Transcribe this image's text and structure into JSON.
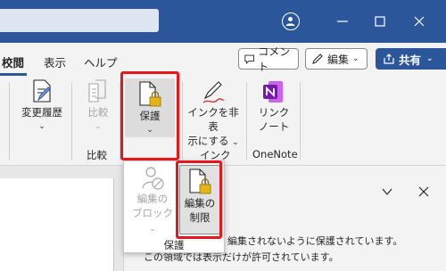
{
  "header": {
    "tabs": [
      {
        "label": "校閲",
        "active": true
      },
      {
        "label": "表示"
      },
      {
        "label": "ヘルプ"
      }
    ],
    "comment_label": "コメント",
    "edit_label": "編集",
    "share_label": "共有"
  },
  "ribbon": {
    "track_changes": {
      "line1": "変更履歴",
      "chev": "⌄"
    },
    "compare": {
      "line1": "比較",
      "chev": "⌄",
      "group_label": "比較"
    },
    "protect": {
      "line1": "保護",
      "chev": "⌄"
    },
    "ink": {
      "line1": "インクを非表",
      "line2": "示にする",
      "chev": "⌄",
      "group_label": "インク"
    },
    "onenote": {
      "line1": "リンク",
      "line2": "ノート",
      "group_label": "OneNote"
    }
  },
  "protect_menu": {
    "block_authors": {
      "line1": "編集の",
      "line2": "ブロック",
      "chev": "⌄",
      "disabled": true
    },
    "restrict_editing": {
      "line1": "編集の",
      "line2": "制限"
    },
    "group_label": "保護"
  },
  "pane": {
    "line1": "編集されないように保護されています。",
    "line2": "この領域では表示だけが許可されています。"
  },
  "colors": {
    "accent": "#2b579a",
    "highlight": "#e8151b"
  }
}
